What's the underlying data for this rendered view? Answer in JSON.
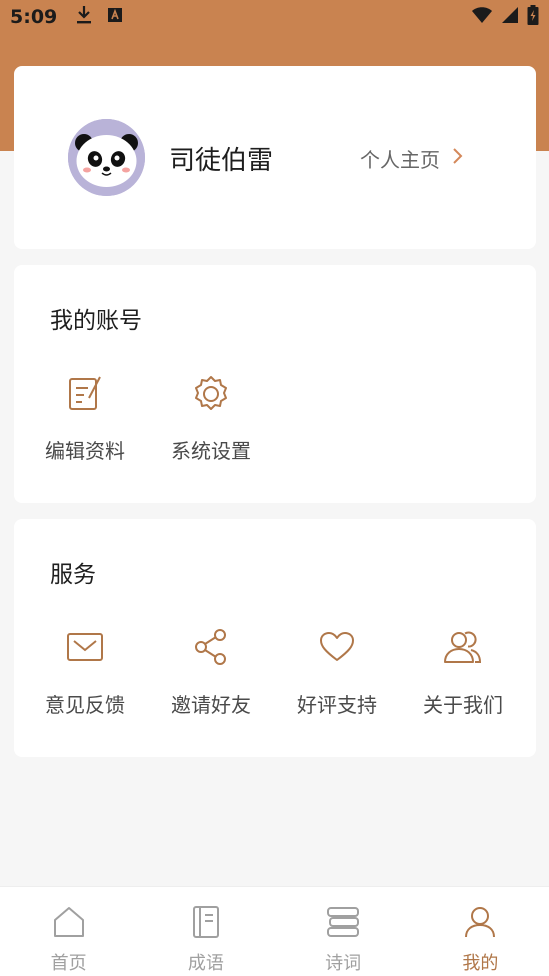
{
  "status_bar": {
    "time": "5:09",
    "left_icons": [
      "download-icon",
      "app-notification-icon"
    ],
    "right_icons": [
      "wifi-icon",
      "signal-icon",
      "battery-charging-icon"
    ]
  },
  "colors": {
    "accent": "#c98350",
    "icon": "#b07749",
    "active_tab": "#b07749",
    "inactive_tab": "#a0a0a0"
  },
  "profile": {
    "name": "司徒伯雷",
    "home_link": "个人主页",
    "avatar_icon": "panda-avatar"
  },
  "account": {
    "title": "我的账号",
    "items": [
      {
        "label": "编辑资料",
        "icon": "edit-profile-icon"
      },
      {
        "label": "系统设置",
        "icon": "settings-icon"
      }
    ]
  },
  "services": {
    "title": "服务",
    "items": [
      {
        "label": "意见反馈",
        "icon": "feedback-mail-icon"
      },
      {
        "label": "邀请好友",
        "icon": "share-icon"
      },
      {
        "label": "好评支持",
        "icon": "heart-icon"
      },
      {
        "label": "关于我们",
        "icon": "users-icon"
      }
    ]
  },
  "tabbar": {
    "items": [
      {
        "label": "首页",
        "icon": "home-icon",
        "active": false
      },
      {
        "label": "成语",
        "icon": "book-icon",
        "active": false
      },
      {
        "label": "诗词",
        "icon": "books-stack-icon",
        "active": false
      },
      {
        "label": "我的",
        "icon": "person-icon",
        "active": true
      }
    ]
  }
}
